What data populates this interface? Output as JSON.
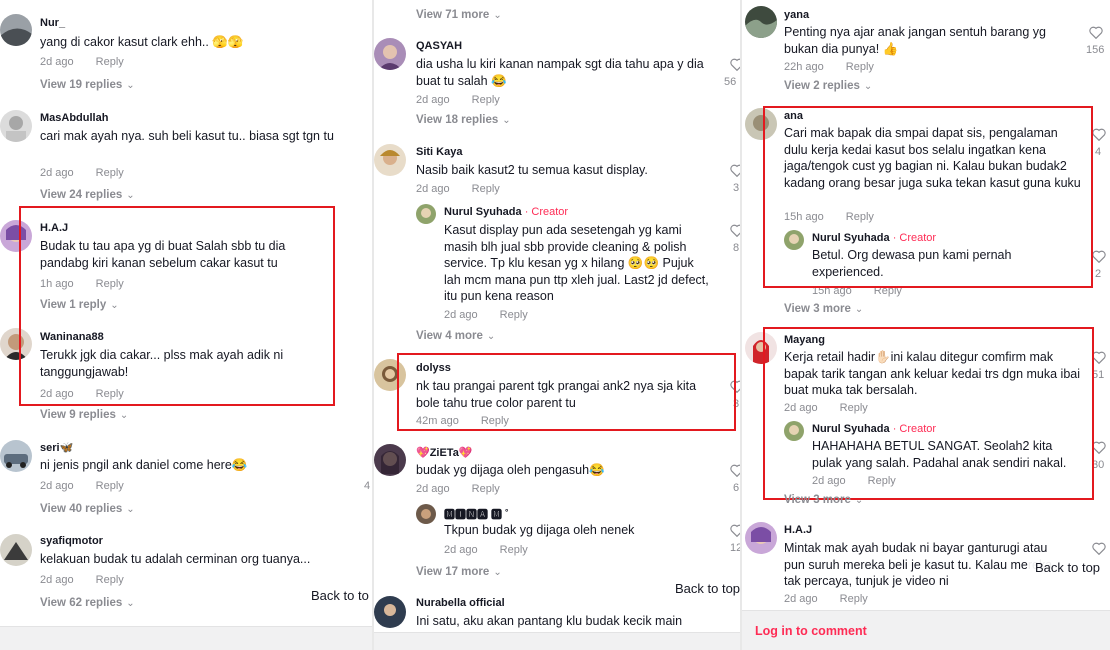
{
  "panel1": {
    "comments": [
      {
        "user": "Nur_",
        "text": "yang di cakor kasut clark ehh.. 🫣🫣",
        "age": "2d ago",
        "reply": "Reply",
        "view": "View 19 replies"
      },
      {
        "user": "MasAbdullah",
        "text": "cari mak ayah nya. suh beli kasut tu.. biasa sgt tgn tu",
        "age": "2d ago",
        "reply": "Reply",
        "view": "View 24 replies"
      },
      {
        "user": "H.A.J",
        "text": "Budak tu tau apa yg di buat Salah sbb tu dia pandabg kiri kanan sebelum cakar kasut tu",
        "age": "1h ago",
        "reply": "Reply",
        "view": "View 1 reply"
      },
      {
        "user": "Waninana88",
        "text": "Terukk jgk dia cakar... plss mak ayah adik ni tanggungjawab!",
        "age": "2d ago",
        "reply": "Reply",
        "view": "View 9 replies"
      },
      {
        "user": "seri🦋",
        "text": "ni jenis pngil ank daniel come here😂",
        "age": "2d ago",
        "reply": "Reply",
        "view": "View 40 replies",
        "likes": "4"
      },
      {
        "user": "syafiqmotor",
        "text": "kelakuan budak tu adalah cerminan org tuanya...",
        "age": "2d ago",
        "reply": "Reply",
        "view": "View 62 replies"
      }
    ],
    "back_to_top": "Back to to"
  },
  "panel2": {
    "top_view": "View 71 more",
    "comments": [
      {
        "user": "QASYAH",
        "text": "dia usha lu kiri kanan nampak sgt dia tahu apa y dia buat tu salah 😂",
        "age": "2d ago",
        "reply": "Reply",
        "view": "View 18 replies",
        "likes": "56"
      },
      {
        "user": "Siti Kaya",
        "text": "Nasib baik kasut2 tu semua kasut display.",
        "age": "2d ago",
        "reply": "Reply",
        "likes": "3"
      },
      {
        "user": "Nurul Syuhada",
        "creator": "· Creator",
        "text": "Kasut display pun ada sesetengah yg kami masih blh jual sbb provide cleaning & polish service. Tp klu kesan yg x hilang 🥺🥺 Pujuk lah mcm mana pun ttp xleh jual. Last2 jd defect, itu pun kena reason",
        "age": "2d ago",
        "reply": "Reply",
        "view": "View 4 more",
        "likes": "8"
      },
      {
        "user": "dolyss",
        "text": "nk tau prangai parent tgk prangai ank2 nya sja kita bole tahu true color parent tu",
        "age": "42m ago",
        "reply": "Reply",
        "likes": "3"
      },
      {
        "user": "💖ZiETa💖",
        "text": "budak yg dijaga oleh pengasuh😂",
        "age": "2d ago",
        "reply": "Reply",
        "likes": "6"
      },
      {
        "user": "🅼🅸🅽🅰 🅼 ˚",
        "text": "Tkpun budak yg dijaga oleh nenek",
        "age": "2d ago",
        "reply": "Reply",
        "view": "View 17 more",
        "likes": "12"
      },
      {
        "user": "Nurabella official",
        "text": "Ini satu, aku akan pantang klu budak kecik main"
      }
    ],
    "back_to_top": "Back to top"
  },
  "panel3": {
    "comments": [
      {
        "user": "yana",
        "text": "Penting nya ajar anak jangan sentuh barang yg bukan dia punya! 👍",
        "age": "22h ago",
        "reply": "Reply",
        "view": "View 2 replies",
        "likes": "156"
      },
      {
        "user": "ana",
        "text": "Cari mak bapak dia smpai dapat sis, pengalaman dulu kerja kedai kasut bos selalu ingatkan kena jaga/tengok cust yg bagian ni. Kalau bukan budak2 kadang orang besar juga suka tekan kasut guna kuku",
        "age": "15h ago",
        "reply": "Reply",
        "likes": "4"
      },
      {
        "user": "Nurul Syuhada",
        "creator": "· Creator",
        "text": "Betul. Org dewasa pun kami pernah experienced.",
        "age": "15h ago",
        "reply": "Reply",
        "view": "View 3 more",
        "likes": "2"
      },
      {
        "user": "Mayang",
        "text": "Kerja retail hadir✋🏻ini kalau ditegur comfirm mak bapak tarik tangan ank keluar kedai trs dgn muka ibai buat muka tak bersalah.",
        "age": "2d ago",
        "reply": "Reply",
        "likes": "51"
      },
      {
        "user": "Nurul Syuhada",
        "creator": "· Creator",
        "text": "HAHAHAHA BETUL SANGAT. Seolah2 kita pulak yang salah. Padahal anak sendiri nakal.",
        "age": "2d ago",
        "reply": "Reply",
        "view": "View 3 more",
        "likes": "30"
      },
      {
        "user": "H.A.J",
        "text": "Mintak mak ayah budak ni bayar ganturugi atau pun suruh mereka beli je kasut tu. Kalau mereka tak percaya, tunjuk je video ni",
        "age": "2d ago",
        "reply": "Reply"
      }
    ],
    "back_to_top": "Back to top",
    "login": "Log in to comment"
  },
  "colors": {
    "accent": "#fe2c55",
    "muted": "#8a8b91",
    "highlight_box": "#e3191f"
  },
  "icons": {
    "heart": "heart-outline-icon",
    "chevron": "chevron-down-icon"
  }
}
